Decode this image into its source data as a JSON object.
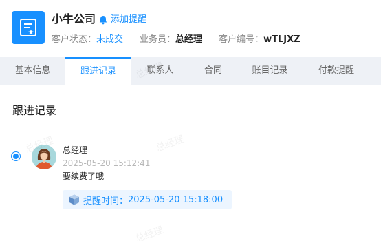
{
  "company": {
    "name": "小牛公司",
    "reminder_link": "添加提醒",
    "status_label": "客户状态：",
    "status_value": "未成交",
    "salesperson_label": "业务员：",
    "salesperson_value": "总经理",
    "code_label": "客户编号：",
    "code_value": "wTLJXZ"
  },
  "tabs": [
    {
      "label": "基本信息",
      "active": false
    },
    {
      "label": "跟进记录",
      "active": true
    },
    {
      "label": "联系人",
      "active": false
    },
    {
      "label": "合同",
      "active": false
    },
    {
      "label": "账目记录",
      "active": false
    },
    {
      "label": "付款提醒",
      "active": false
    }
  ],
  "section": {
    "title": "跟进记录"
  },
  "record": {
    "author": "总经理",
    "timestamp": "2025-05-20 15:12:41",
    "content": "要续费了哦",
    "remind_label": "提醒时间：",
    "remind_time": "2025-05-20 15:18:00"
  },
  "watermark": "总经理",
  "colors": {
    "accent": "#1890ff",
    "tab_bg": "#eef1f6",
    "remind_bg": "#ecf5ff"
  }
}
